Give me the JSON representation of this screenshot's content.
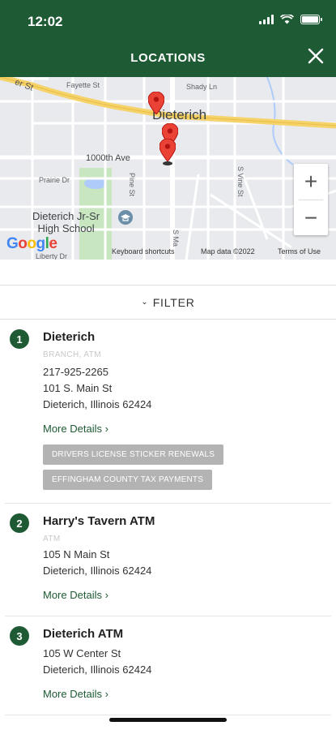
{
  "status_bar": {
    "time": "12:02"
  },
  "header": {
    "title": "LOCATIONS",
    "close_icon": "close-icon"
  },
  "map": {
    "town": "Dieterich",
    "streets": [
      "er St",
      "Fayette St",
      "Shady Ln",
      "1000th Ave",
      "Prairie Dr",
      "Pine St",
      "S Vine St",
      "S Ma",
      "Liberty Dr"
    ],
    "school": [
      "Dieterich Jr-Sr",
      "High School"
    ],
    "zoom_in": "+",
    "zoom_out": "−",
    "logo": "Google",
    "keyboard_shortcuts": "Keyboard shortcuts",
    "map_data": "Map data ©2022",
    "terms": "Terms of Use",
    "colors": {
      "highway": "#f6d36a",
      "park": "#c8e6c0",
      "water": "#aecbfa",
      "pin": "#ea4335"
    }
  },
  "filter": {
    "label": "FILTER",
    "icon": "chevron-down-icon"
  },
  "locations": [
    {
      "number": "1",
      "name": "Dieterich",
      "type": "BRANCH, ATM",
      "phone": "217-925-2265",
      "address1": "101 S. Main St",
      "address2": "Dieterich, Illinois 62424",
      "more": "More Details ›",
      "tags": [
        "DRIVERS LICENSE STICKER RENEWALS",
        "EFFINGHAM COUNTY TAX PAYMENTS"
      ]
    },
    {
      "number": "2",
      "name": "Harry's Tavern ATM",
      "type": "ATM",
      "address1": "105 N Main St",
      "address2": "Dieterich, Illinois 62424",
      "more": "More Details ›"
    },
    {
      "number": "3",
      "name": "Dieterich ATM",
      "address1": "105 W Center St",
      "address2": "Dieterich, Illinois 62424",
      "more": "More Details ›"
    }
  ],
  "theme": {
    "brand": "#1e5a33",
    "tag_bg": "#b3b3b3"
  }
}
